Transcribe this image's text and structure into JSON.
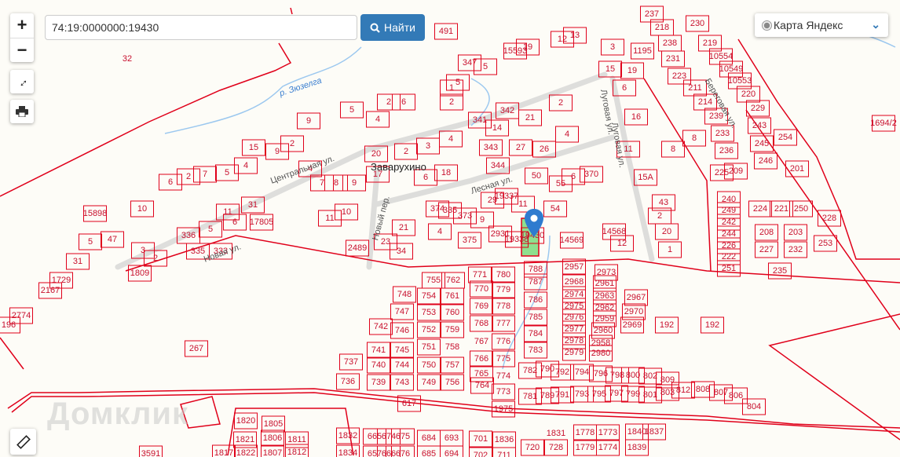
{
  "search": {
    "value": "74:19:0000000:19430",
    "button_label": "Найти"
  },
  "controls": {
    "zoom_in": "+",
    "zoom_out": "−"
  },
  "layer_select": {
    "selected": "Карта Яндекс"
  },
  "place_name": "Заварухино",
  "river_name": "р. Зюзелга",
  "watermark": "Домклик",
  "highlight_color": "#8ee08e",
  "parcel_line_color": "#e0001a",
  "streets": [
    "Центральная ул.",
    "Лесная ул.",
    "Новая ул.",
    "Луговая ул.",
    "Береговая ул.",
    "Новый пер.",
    "Луговая ул."
  ],
  "parcels": [
    "32",
    "491",
    "347",
    "5",
    "15593",
    "19",
    "12",
    "13",
    "237",
    "218",
    "238",
    "231",
    "223",
    "230",
    "219",
    "10554",
    "10549",
    "10553",
    "211",
    "214",
    "220",
    "229",
    "239",
    "243",
    "233",
    "245",
    "254",
    "236",
    "246",
    "201",
    "225",
    "209",
    "240",
    "249",
    "242",
    "244",
    "226",
    "222",
    "251",
    "224",
    "221",
    "250",
    "208",
    "203",
    "227",
    "232",
    "228",
    "253",
    "235",
    "1694/2",
    "3",
    "1195",
    "15",
    "19",
    "6",
    "16",
    "11",
    "8",
    "8",
    "43",
    "2",
    "20",
    "1",
    "14568",
    "12",
    "14569",
    "15А",
    "5",
    "2",
    "6",
    "4",
    "1",
    "2",
    "5",
    "9",
    "2",
    "15",
    "9",
    "4",
    "5",
    "7",
    "2",
    "6",
    "4",
    "20",
    "17",
    "3",
    "4",
    "2",
    "6",
    "18",
    "9",
    "8",
    "7",
    "10",
    "11",
    "11",
    "10",
    "31",
    "17805",
    "6",
    "5",
    "336",
    "335",
    "333",
    "3",
    "2",
    "1809",
    "15898",
    "47",
    "5",
    "31",
    "1729",
    "2167",
    "2774",
    "196",
    "341",
    "342",
    "14",
    "343",
    "27",
    "26",
    "344",
    "21",
    "2",
    "4",
    "50",
    "55",
    "6",
    "370",
    "54",
    "11",
    "19337",
    "29",
    "9",
    "2931",
    "19338",
    "19430",
    "374",
    "335",
    "373",
    "4",
    "375",
    "21",
    "23",
    "34",
    "2489",
    "788",
    "2957",
    "2973",
    "771",
    "780",
    "755",
    "762",
    "787",
    "2968",
    "2961",
    "748",
    "754",
    "761",
    "770",
    "779",
    "786",
    "2974",
    "2963",
    "2967",
    "747",
    "753",
    "760",
    "769",
    "778",
    "2975",
    "2962",
    "2970",
    "192",
    "192",
    "785",
    "2976",
    "2959",
    "742",
    "746",
    "752",
    "759",
    "768",
    "777",
    "2977",
    "2960",
    "2969",
    "784",
    "2978",
    "2958",
    "741",
    "745",
    "751",
    "758",
    "767",
    "776",
    "2979",
    "2980",
    "783",
    "737",
    "740",
    "744",
    "750",
    "757",
    "766",
    "775",
    "782",
    "790",
    "792",
    "794",
    "796",
    "798",
    "800",
    "802",
    "809",
    "736",
    "739",
    "743",
    "749",
    "756",
    "765",
    "774",
    "764",
    "773",
    "781",
    "789",
    "791",
    "793",
    "795",
    "797",
    "799",
    "801",
    "803",
    "812",
    "808",
    "807",
    "806",
    "804",
    "617",
    "1975",
    "267",
    "1820",
    "1805",
    "1821",
    "1806",
    "1811",
    "1832",
    "665",
    "674",
    "675",
    "684",
    "693",
    "701",
    "1836",
    "1831",
    "1778",
    "1773",
    "1840",
    "1837",
    "720",
    "728",
    "1779",
    "1774",
    "1839",
    "1817",
    "1822",
    "1807",
    "1812",
    "1834",
    "657",
    "666",
    "676",
    "685",
    "694",
    "702",
    "711",
    "3591"
  ]
}
